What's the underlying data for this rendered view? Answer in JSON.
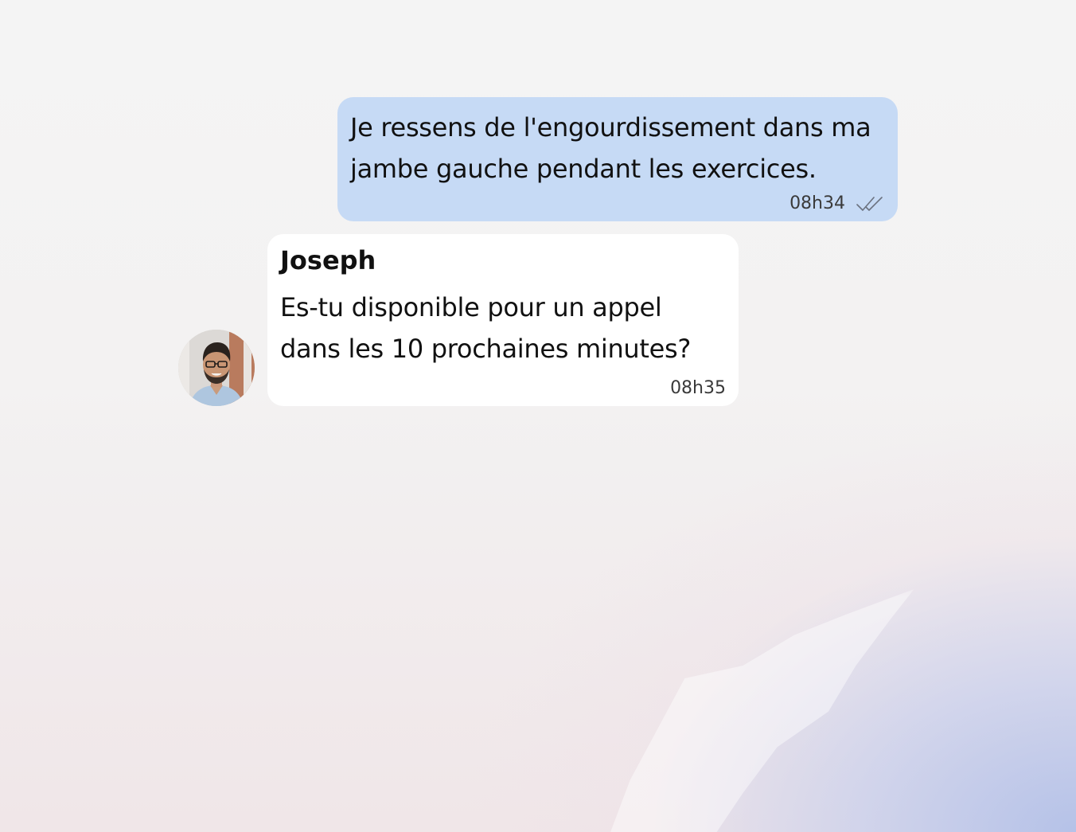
{
  "conversation": {
    "messages": [
      {
        "direction": "outgoing",
        "text": "Je ressens de l'engourdissement dans ma jambe gauche pendant les exercices.",
        "time": "08h34",
        "status_icon": "double-check-icon"
      },
      {
        "direction": "incoming",
        "sender": "Joseph",
        "text": "Es-tu disponible pour un appel dans les 10 prochaines minutes?",
        "time": "08h35",
        "avatar_icon": "avatar"
      }
    ]
  },
  "colors": {
    "outgoing_bubble": "#c6daf5",
    "incoming_bubble": "#ffffff",
    "background": "#f3f3f3",
    "background_accent": "#b2c0e8"
  }
}
